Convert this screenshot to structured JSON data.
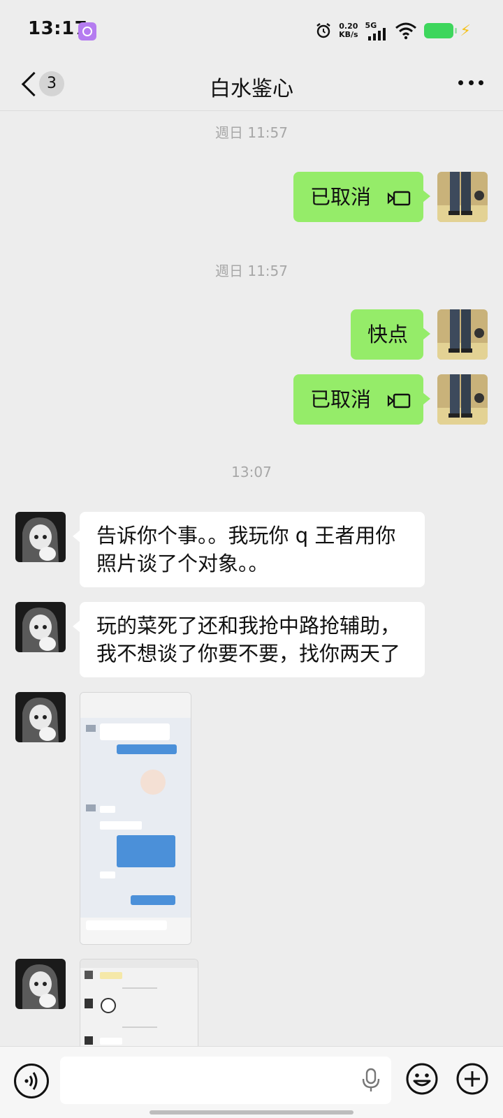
{
  "status_bar": {
    "time": "13:17",
    "net_speed_value": "0.20",
    "net_speed_unit": "KB/s",
    "network": "5G",
    "battery_color": "#3dd65c"
  },
  "header": {
    "back_badge": "3",
    "title": "白水鉴心"
  },
  "messages": {
    "ts1": "週日 11:57",
    "m1": "已取消",
    "ts2": "週日 11:57",
    "m2": "快点",
    "m3": "已取消",
    "ts3": "13:07",
    "m4_line1": "告诉你个事。。我玩你 q 王者用你",
    "m4_line2": "照片谈了个对象。。",
    "m5_line1": "玩的菜死了还和我抢中路抢辅助，",
    "m5_line2": "我不想谈了你要不要，找你两天了"
  },
  "colors": {
    "self_bubble": "#95ec69",
    "other_bubble": "#ffffff",
    "background": "#ededed"
  }
}
